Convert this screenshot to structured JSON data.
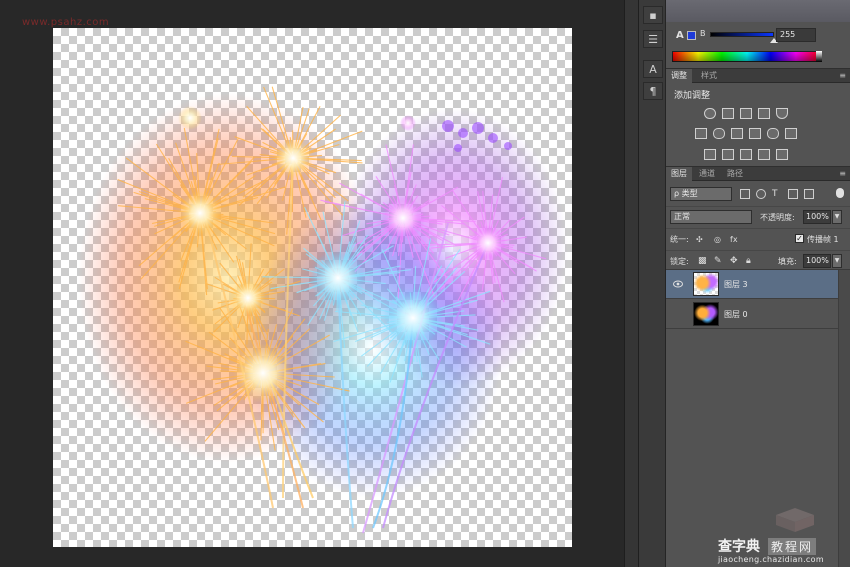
{
  "canvas": {
    "source_mark": "www.psahz.com"
  },
  "colors": {
    "workspace_bg": "#282828",
    "panel_bg": "#535353",
    "selected_layer": "#5b6e86",
    "blue_swatch": "#1e3bd8"
  },
  "dock_strip": {
    "icons": [
      "brush-presets-icon",
      "sliders-icon",
      "character-icon",
      "paragraph-icon"
    ]
  },
  "color_panel": {
    "slider_letter": "A",
    "channel_label": "B",
    "channel_value": "255"
  },
  "adjustments_panel": {
    "tabs": [
      "调整",
      "样式"
    ],
    "title": "添加调整",
    "icons_row1": [
      "brightness-icon",
      "levels-icon",
      "curves-icon",
      "exposure-icon",
      "vibrance-icon"
    ],
    "icons_row2": [
      "hue-sat-icon",
      "color-balance-icon",
      "black-white-icon",
      "photo-filter-icon",
      "channel-mixer-icon",
      "color-lookup-icon"
    ],
    "icons_row3": [
      "invert-icon",
      "posterize-icon",
      "threshold-icon",
      "selective-color-icon",
      "gradient-map-icon"
    ]
  },
  "layers_panel": {
    "tabs": [
      "图层",
      "通道",
      "路径"
    ],
    "filter_kind": "ρ 类型",
    "blend_mode": "正常",
    "opacity_label": "不透明度:",
    "opacity_value": "100%",
    "unify_label": "统一:",
    "propagate_label": "传播帧 1",
    "lock_label": "锁定:",
    "fill_label": "填充:",
    "fill_value": "100%",
    "layers": [
      {
        "name": "图层 3",
        "visible": true,
        "selected": true
      },
      {
        "name": "图层 0",
        "visible": false,
        "selected": false
      }
    ]
  },
  "watermark": {
    "logo": "查字典",
    "tag": "教程网",
    "url": "jiaocheng.chazidian.com"
  }
}
